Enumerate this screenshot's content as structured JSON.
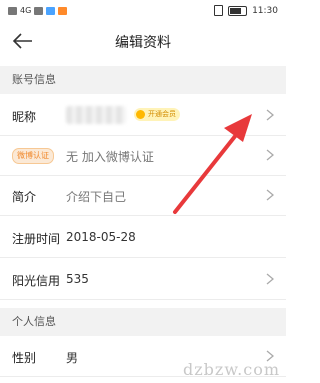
{
  "status": {
    "time": "11:30",
    "left_text": "4G"
  },
  "header": {
    "title": "编辑资料"
  },
  "sections": {
    "account": {
      "title": "账号信息",
      "nickname_label": "昵称",
      "vip_badge": "开通会员",
      "weibo_badge": "微博认证",
      "weibo_value": "无 加入微博认证",
      "intro_label": "简介",
      "intro_value": "介绍下自己",
      "register_label": "注册时间",
      "register_value": "2018-05-28",
      "credit_label": "阳光信用",
      "credit_value": "535"
    },
    "personal": {
      "title": "个人信息",
      "gender_label": "性别",
      "gender_value": "男"
    }
  },
  "annotation": {
    "arrow_color": "#e8393b"
  },
  "watermark": "dzbzw.com"
}
